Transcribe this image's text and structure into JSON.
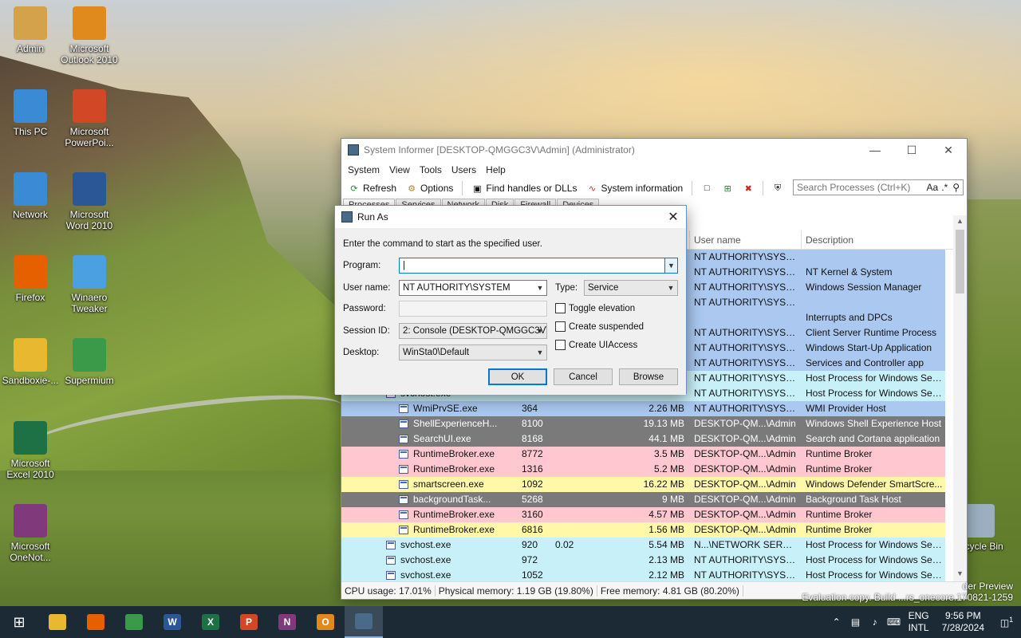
{
  "desktop_icons": [
    {
      "label": "Admin",
      "color": "#d4a24a"
    },
    {
      "label": "Microsoft Outlook 2010",
      "color": "#e08a1e"
    },
    {
      "label": "This PC",
      "color": "#3a8ad6"
    },
    {
      "label": "Microsoft PowerPoi...",
      "color": "#d24726"
    },
    {
      "label": "Network",
      "color": "#3a8ad6"
    },
    {
      "label": "Microsoft Word 2010",
      "color": "#2b5797"
    },
    {
      "label": "Firefox",
      "color": "#e66000"
    },
    {
      "label": "Winaero Tweaker",
      "color": "#4aa0e0"
    },
    {
      "label": "Sandboxie-...",
      "color": "#e8b830"
    },
    {
      "label": "Supermium",
      "color": "#3a9a4a"
    },
    {
      "label": "Microsoft Excel 2010",
      "color": "#1e7145"
    },
    {
      "label": "Microsoft OneNot...",
      "color": "#80397b"
    },
    {
      "label": "Recycle Bin",
      "color": "#9ab0c0"
    }
  ],
  "main_window": {
    "title": "System Informer [DESKTOP-QMGGC3V\\Admin] (Administrator)",
    "menu": [
      "System",
      "View",
      "Tools",
      "Users",
      "Help"
    ],
    "toolbar": {
      "refresh": "Refresh",
      "options": "Options",
      "find_handles": "Find handles or DLLs",
      "system_info": "System information"
    },
    "search_placeholder": "Search Processes (Ctrl+K)",
    "search_case": "Aa",
    "search_regex": ".*",
    "tabs": [
      "Processes",
      "Services",
      "Network",
      "Disk",
      "Firewall",
      "Devices"
    ],
    "columns": {
      "user_name": "User name",
      "description": "Description"
    },
    "rows": [
      {
        "name": "",
        "pid": "",
        "cpu": "",
        "io": "",
        "mem": "",
        "user": "NT AUTHORITY\\SYSTEM",
        "desc": "",
        "bg": "#aac8f0",
        "indent": 0
      },
      {
        "name": "",
        "pid": "",
        "cpu": "",
        "io": "",
        "mem": "",
        "user": "NT AUTHORITY\\SYSTEM",
        "desc": "NT Kernel & System",
        "bg": "#aac8f0",
        "indent": 0
      },
      {
        "name": "",
        "pid": "",
        "cpu": "",
        "io": "",
        "mem": "",
        "user": "NT AUTHORITY\\SYSTEM",
        "desc": "Windows Session Manager",
        "bg": "#aac8f0",
        "indent": 0
      },
      {
        "name": "",
        "pid": "",
        "cpu": "",
        "io": "",
        "mem": "",
        "user": "NT AUTHORITY\\SYSTEM",
        "desc": "",
        "bg": "#aac8f0",
        "indent": 0
      },
      {
        "name": "",
        "pid": "",
        "cpu": "",
        "io": "",
        "mem": "",
        "user": "",
        "desc": "Interrupts and DPCs",
        "bg": "#aac8f0",
        "indent": 0
      },
      {
        "name": "",
        "pid": "",
        "cpu": "",
        "io": "",
        "mem": "",
        "user": "NT AUTHORITY\\SYSTEM",
        "desc": "Client Server Runtime Process",
        "bg": "#aac8f0",
        "indent": 0
      },
      {
        "name": "",
        "pid": "",
        "cpu": "",
        "io": "",
        "mem": "",
        "user": "NT AUTHORITY\\SYSTEM",
        "desc": "Windows Start-Up Application",
        "bg": "#aac8f0",
        "indent": 0
      },
      {
        "name": "",
        "pid": "",
        "cpu": "",
        "io": "",
        "mem": "",
        "user": "NT AUTHORITY\\SYSTEM",
        "desc": "Services and Controller app",
        "bg": "#aac8f0",
        "indent": 0
      },
      {
        "name": "",
        "pid": "",
        "cpu": "",
        "io": "",
        "mem": "",
        "user": "NT AUTHORITY\\SYSTEM",
        "desc": "Host Process for Windows Ser...",
        "bg": "#c8f0f8",
        "indent": 0
      },
      {
        "name": "svchost.exe",
        "pid": "",
        "cpu": "",
        "io": "",
        "mem": "",
        "user": "NT AUTHORITY\\SYSTEM",
        "desc": "Host Process for Windows Ser...",
        "bg": "#c8f0f8",
        "indent": 1
      },
      {
        "name": "WmiPrvSE.exe",
        "pid": "364",
        "cpu": "",
        "io": "",
        "mem": "2.26 MB",
        "user": "NT AUTHORITY\\SYSTEM",
        "desc": "WMI Provider Host",
        "bg": "#aac8f0",
        "indent": 2
      },
      {
        "name": "ShellExperienceH...",
        "pid": "8100",
        "cpu": "",
        "io": "",
        "mem": "19.13 MB",
        "user": "DESKTOP-QM...\\Admin",
        "desc": "Windows Shell Experience Host",
        "bg": "#7a7a7a",
        "indent": 2,
        "light": true
      },
      {
        "name": "SearchUI.exe",
        "pid": "8168",
        "cpu": "",
        "io": "",
        "mem": "44.1 MB",
        "user": "DESKTOP-QM...\\Admin",
        "desc": "Search and Cortana application",
        "bg": "#7a7a7a",
        "indent": 2,
        "light": true
      },
      {
        "name": "RuntimeBroker.exe",
        "pid": "8772",
        "cpu": "",
        "io": "",
        "mem": "3.5 MB",
        "user": "DESKTOP-QM...\\Admin",
        "desc": "Runtime Broker",
        "bg": "#ffc8d0",
        "indent": 2
      },
      {
        "name": "RuntimeBroker.exe",
        "pid": "1316",
        "cpu": "",
        "io": "",
        "mem": "5.2 MB",
        "user": "DESKTOP-QM...\\Admin",
        "desc": "Runtime Broker",
        "bg": "#ffc8d0",
        "indent": 2
      },
      {
        "name": "smartscreen.exe",
        "pid": "1092",
        "cpu": "",
        "io": "",
        "mem": "16.22 MB",
        "user": "DESKTOP-QM...\\Admin",
        "desc": "Windows Defender SmartScre...",
        "bg": "#fff8a8",
        "indent": 2
      },
      {
        "name": "backgroundTask...",
        "pid": "5268",
        "cpu": "",
        "io": "",
        "mem": "9 MB",
        "user": "DESKTOP-QM...\\Admin",
        "desc": "Background Task Host",
        "bg": "#7a7a7a",
        "indent": 2,
        "light": true
      },
      {
        "name": "RuntimeBroker.exe",
        "pid": "3160",
        "cpu": "",
        "io": "",
        "mem": "4.57 MB",
        "user": "DESKTOP-QM...\\Admin",
        "desc": "Runtime Broker",
        "bg": "#ffc8d0",
        "indent": 2
      },
      {
        "name": "RuntimeBroker.exe",
        "pid": "6816",
        "cpu": "",
        "io": "",
        "mem": "1.56 MB",
        "user": "DESKTOP-QM...\\Admin",
        "desc": "Runtime Broker",
        "bg": "#fff8a8",
        "indent": 2
      },
      {
        "name": "svchost.exe",
        "pid": "920",
        "cpu": "0.02",
        "io": "",
        "mem": "5.54 MB",
        "user": "N...\\NETWORK SERVICE",
        "desc": "Host Process for Windows Ser...",
        "bg": "#c8f0f8",
        "indent": 1
      },
      {
        "name": "svchost.exe",
        "pid": "972",
        "cpu": "",
        "io": "",
        "mem": "2.13 MB",
        "user": "NT AUTHORITY\\SYSTEM",
        "desc": "Host Process for Windows Ser...",
        "bg": "#c8f0f8",
        "indent": 1
      },
      {
        "name": "svchost.exe",
        "pid": "1052",
        "cpu": "",
        "io": "",
        "mem": "2.12 MB",
        "user": "NT AUTHORITY\\SYSTEM",
        "desc": "Host Process for Windows Ser...",
        "bg": "#c8f0f8",
        "indent": 1
      }
    ],
    "status": {
      "cpu": "CPU usage: 17.01%",
      "physical": "Physical memory: 1.19 GB (19.80%)",
      "free": "Free memory: 4.81 GB (80.20%)"
    }
  },
  "run_as_dialog": {
    "title": "Run As",
    "instruction": "Enter the command to start as the specified user.",
    "program_label": "Program:",
    "program_value": "|",
    "username_label": "User name:",
    "username_value": "NT AUTHORITY\\SYSTEM",
    "type_label": "Type:",
    "type_value": "Service",
    "password_label": "Password:",
    "session_label": "Session ID:",
    "session_value": "2: Console (DESKTOP-QMGGC3V\\",
    "desktop_label": "Desktop:",
    "desktop_value": "WinSta0\\Default",
    "toggle_elevation": "Toggle elevation",
    "create_suspended": "Create suspended",
    "create_uiaccess": "Create UIAccess",
    "ok": "OK",
    "cancel": "Cancel",
    "browse": "Browse"
  },
  "taskbar": {
    "apps": [
      {
        "name": "file-explorer",
        "color": "#e8b830"
      },
      {
        "name": "firefox",
        "color": "#e66000"
      },
      {
        "name": "supermium",
        "color": "#3a9a4a"
      },
      {
        "name": "word",
        "color": "#2b5797",
        "glyph": "W"
      },
      {
        "name": "excel",
        "color": "#1e7145",
        "glyph": "X"
      },
      {
        "name": "powerpoint",
        "color": "#d24726",
        "glyph": "P"
      },
      {
        "name": "onenote",
        "color": "#80397b",
        "glyph": "N"
      },
      {
        "name": "outlook",
        "color": "#e08a1e",
        "glyph": "O"
      },
      {
        "name": "system-informer",
        "color": "#4a6a8a"
      }
    ],
    "lang_top": "ENG",
    "lang_bottom": "INTL",
    "time": "9:56 PM",
    "date": "7/28/2024",
    "notification_count": "1"
  },
  "watermark": {
    "line1": "der Preview",
    "line2": "Evaluation copy. Build ...rs_onecore.170821-1259"
  }
}
